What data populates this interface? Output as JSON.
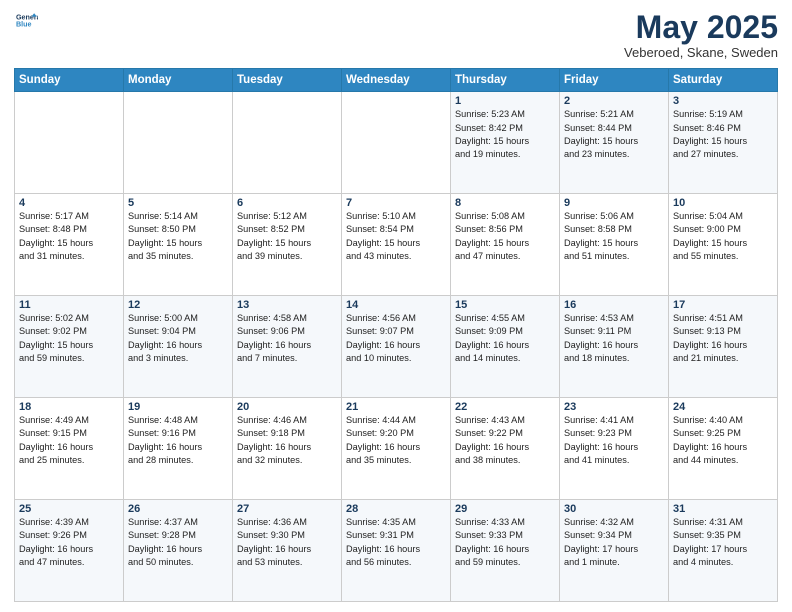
{
  "header": {
    "logo_line1": "General",
    "logo_line2": "Blue",
    "month_title": "May 2025",
    "location": "Veberoed, Skane, Sweden"
  },
  "weekdays": [
    "Sunday",
    "Monday",
    "Tuesday",
    "Wednesday",
    "Thursday",
    "Friday",
    "Saturday"
  ],
  "weeks": [
    [
      {
        "day": "",
        "info": ""
      },
      {
        "day": "",
        "info": ""
      },
      {
        "day": "",
        "info": ""
      },
      {
        "day": "",
        "info": ""
      },
      {
        "day": "1",
        "info": "Sunrise: 5:23 AM\nSunset: 8:42 PM\nDaylight: 15 hours\nand 19 minutes."
      },
      {
        "day": "2",
        "info": "Sunrise: 5:21 AM\nSunset: 8:44 PM\nDaylight: 15 hours\nand 23 minutes."
      },
      {
        "day": "3",
        "info": "Sunrise: 5:19 AM\nSunset: 8:46 PM\nDaylight: 15 hours\nand 27 minutes."
      }
    ],
    [
      {
        "day": "4",
        "info": "Sunrise: 5:17 AM\nSunset: 8:48 PM\nDaylight: 15 hours\nand 31 minutes."
      },
      {
        "day": "5",
        "info": "Sunrise: 5:14 AM\nSunset: 8:50 PM\nDaylight: 15 hours\nand 35 minutes."
      },
      {
        "day": "6",
        "info": "Sunrise: 5:12 AM\nSunset: 8:52 PM\nDaylight: 15 hours\nand 39 minutes."
      },
      {
        "day": "7",
        "info": "Sunrise: 5:10 AM\nSunset: 8:54 PM\nDaylight: 15 hours\nand 43 minutes."
      },
      {
        "day": "8",
        "info": "Sunrise: 5:08 AM\nSunset: 8:56 PM\nDaylight: 15 hours\nand 47 minutes."
      },
      {
        "day": "9",
        "info": "Sunrise: 5:06 AM\nSunset: 8:58 PM\nDaylight: 15 hours\nand 51 minutes."
      },
      {
        "day": "10",
        "info": "Sunrise: 5:04 AM\nSunset: 9:00 PM\nDaylight: 15 hours\nand 55 minutes."
      }
    ],
    [
      {
        "day": "11",
        "info": "Sunrise: 5:02 AM\nSunset: 9:02 PM\nDaylight: 15 hours\nand 59 minutes."
      },
      {
        "day": "12",
        "info": "Sunrise: 5:00 AM\nSunset: 9:04 PM\nDaylight: 16 hours\nand 3 minutes."
      },
      {
        "day": "13",
        "info": "Sunrise: 4:58 AM\nSunset: 9:06 PM\nDaylight: 16 hours\nand 7 minutes."
      },
      {
        "day": "14",
        "info": "Sunrise: 4:56 AM\nSunset: 9:07 PM\nDaylight: 16 hours\nand 10 minutes."
      },
      {
        "day": "15",
        "info": "Sunrise: 4:55 AM\nSunset: 9:09 PM\nDaylight: 16 hours\nand 14 minutes."
      },
      {
        "day": "16",
        "info": "Sunrise: 4:53 AM\nSunset: 9:11 PM\nDaylight: 16 hours\nand 18 minutes."
      },
      {
        "day": "17",
        "info": "Sunrise: 4:51 AM\nSunset: 9:13 PM\nDaylight: 16 hours\nand 21 minutes."
      }
    ],
    [
      {
        "day": "18",
        "info": "Sunrise: 4:49 AM\nSunset: 9:15 PM\nDaylight: 16 hours\nand 25 minutes."
      },
      {
        "day": "19",
        "info": "Sunrise: 4:48 AM\nSunset: 9:16 PM\nDaylight: 16 hours\nand 28 minutes."
      },
      {
        "day": "20",
        "info": "Sunrise: 4:46 AM\nSunset: 9:18 PM\nDaylight: 16 hours\nand 32 minutes."
      },
      {
        "day": "21",
        "info": "Sunrise: 4:44 AM\nSunset: 9:20 PM\nDaylight: 16 hours\nand 35 minutes."
      },
      {
        "day": "22",
        "info": "Sunrise: 4:43 AM\nSunset: 9:22 PM\nDaylight: 16 hours\nand 38 minutes."
      },
      {
        "day": "23",
        "info": "Sunrise: 4:41 AM\nSunset: 9:23 PM\nDaylight: 16 hours\nand 41 minutes."
      },
      {
        "day": "24",
        "info": "Sunrise: 4:40 AM\nSunset: 9:25 PM\nDaylight: 16 hours\nand 44 minutes."
      }
    ],
    [
      {
        "day": "25",
        "info": "Sunrise: 4:39 AM\nSunset: 9:26 PM\nDaylight: 16 hours\nand 47 minutes."
      },
      {
        "day": "26",
        "info": "Sunrise: 4:37 AM\nSunset: 9:28 PM\nDaylight: 16 hours\nand 50 minutes."
      },
      {
        "day": "27",
        "info": "Sunrise: 4:36 AM\nSunset: 9:30 PM\nDaylight: 16 hours\nand 53 minutes."
      },
      {
        "day": "28",
        "info": "Sunrise: 4:35 AM\nSunset: 9:31 PM\nDaylight: 16 hours\nand 56 minutes."
      },
      {
        "day": "29",
        "info": "Sunrise: 4:33 AM\nSunset: 9:33 PM\nDaylight: 16 hours\nand 59 minutes."
      },
      {
        "day": "30",
        "info": "Sunrise: 4:32 AM\nSunset: 9:34 PM\nDaylight: 17 hours\nand 1 minute."
      },
      {
        "day": "31",
        "info": "Sunrise: 4:31 AM\nSunset: 9:35 PM\nDaylight: 17 hours\nand 4 minutes."
      }
    ]
  ]
}
